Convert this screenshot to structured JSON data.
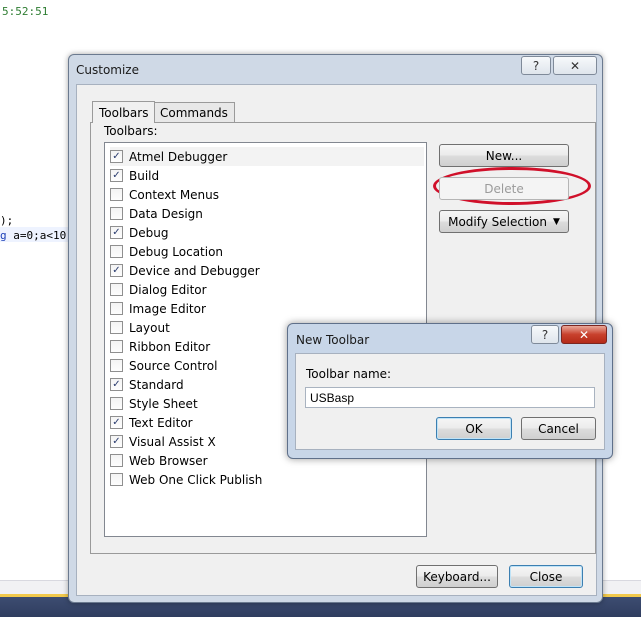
{
  "editor": {
    "time_text": "5:52:51",
    "paren_text": ");",
    "loop_keyword": "g",
    "loop_text": " a=0;a<10"
  },
  "customize": {
    "title": "Customize",
    "help_glyph": "?",
    "close_glyph": "✕",
    "tabs": [
      {
        "label": "Toolbars",
        "active": true
      },
      {
        "label": "Commands",
        "active": false
      }
    ],
    "list_label": "Toolbars:",
    "toolbars": [
      {
        "label": "Atmel Debugger",
        "checked": true
      },
      {
        "label": "Build",
        "checked": true
      },
      {
        "label": "Context Menus",
        "checked": false
      },
      {
        "label": "Data Design",
        "checked": false
      },
      {
        "label": "Debug",
        "checked": true
      },
      {
        "label": "Debug Location",
        "checked": false
      },
      {
        "label": "Device and Debugger",
        "checked": true
      },
      {
        "label": "Dialog Editor",
        "checked": false
      },
      {
        "label": "Image Editor",
        "checked": false
      },
      {
        "label": "Layout",
        "checked": false
      },
      {
        "label": "Ribbon Editor",
        "checked": false
      },
      {
        "label": "Source Control",
        "checked": false
      },
      {
        "label": "Standard",
        "checked": true
      },
      {
        "label": "Style Sheet",
        "checked": false
      },
      {
        "label": "Text Editor",
        "checked": true
      },
      {
        "label": "Visual Assist X",
        "checked": true
      },
      {
        "label": "Web Browser",
        "checked": false
      },
      {
        "label": "Web One Click Publish",
        "checked": false
      }
    ],
    "new_button": "New...",
    "delete_button": "Delete",
    "modify_button": "Modify Selection",
    "modify_arrow": "▼",
    "keyboard_button": "Keyboard...",
    "close_button": "Close"
  },
  "new_toolbar": {
    "title": "New Toolbar",
    "help_glyph": "?",
    "close_glyph": "✕",
    "name_label": "Toolbar name:",
    "name_value": "USBasp",
    "ok_button": "OK",
    "cancel_button": "Cancel"
  },
  "colors": {
    "highlight_ring": "#d0102a",
    "dialog_frame": "#cfd9e6"
  },
  "check_glyph": "✓"
}
